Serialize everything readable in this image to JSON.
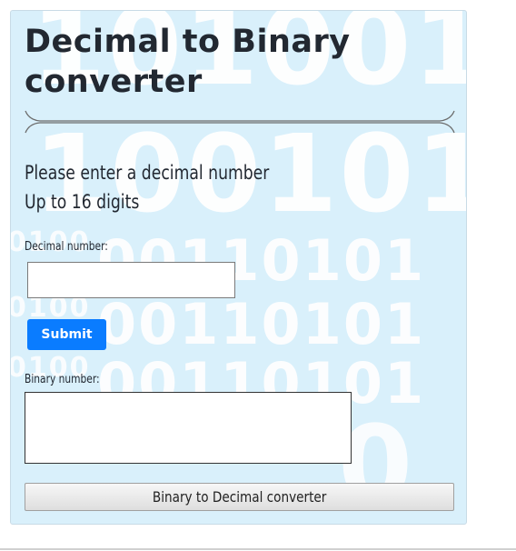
{
  "title": "Decimal to Binary converter",
  "background_digits": {
    "row1": "101001",
    "row2": "100101",
    "row3": "00110101",
    "row4": "00110101",
    "row5": "00110101",
    "row6": "0",
    "side1": "0100",
    "side2": "0100",
    "side3": "0100"
  },
  "instructions": {
    "line1": "Please enter a decimal number",
    "line2": "Up to 16 digits"
  },
  "decimal": {
    "label": "Decimal number:",
    "value": "",
    "placeholder": ""
  },
  "submit_label": "Submit",
  "binary": {
    "label": "Binary number:",
    "value": ""
  },
  "switch_button_label": "Binary to Decimal converter",
  "colors": {
    "card_background": "#d9f0fb",
    "submit_background": "#0a7cff",
    "title_text": "#222831"
  }
}
